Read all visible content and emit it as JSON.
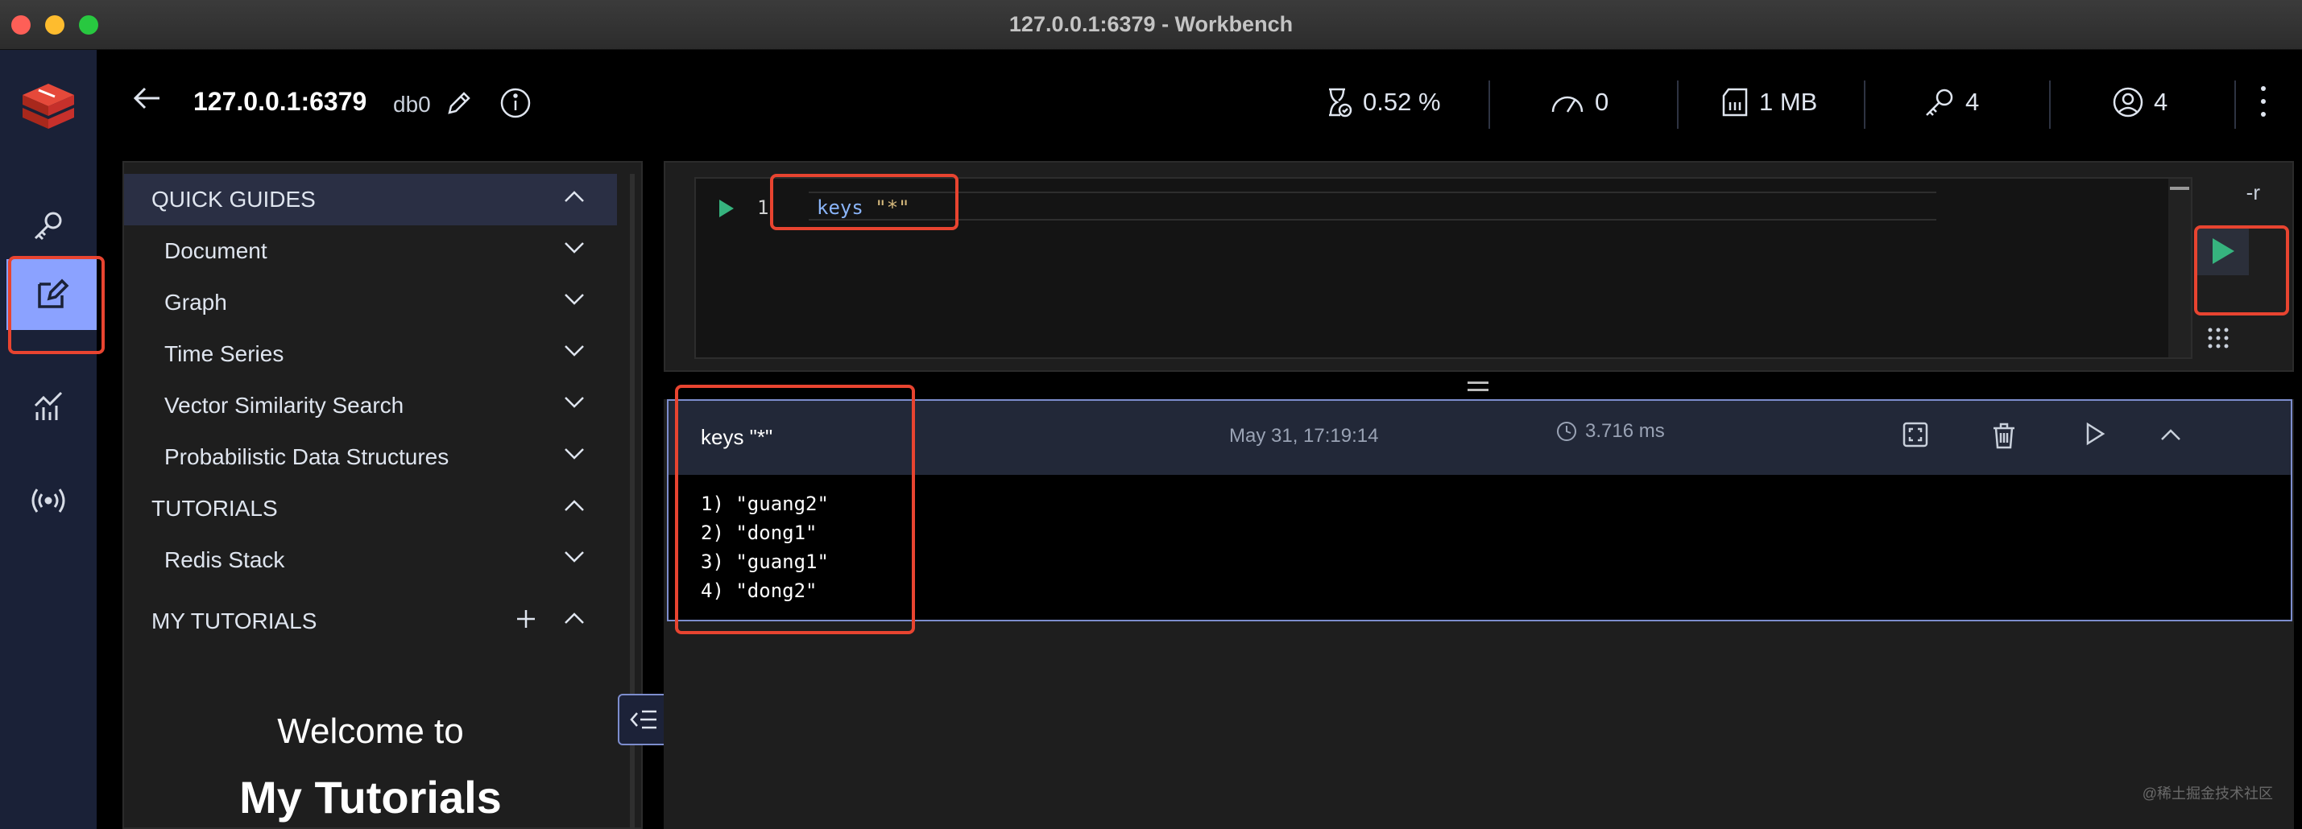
{
  "window": {
    "title": "127.0.0.1:6379 - Workbench"
  },
  "header": {
    "host": "127.0.0.1:6379",
    "db": "db0",
    "stats": {
      "cpu": "0.52 %",
      "ops": "0",
      "memory": "1 MB",
      "keys": "4",
      "clients": "4"
    }
  },
  "nav": {
    "items": [
      "browser",
      "workbench",
      "analytics",
      "pub-sub"
    ],
    "active": "workbench"
  },
  "guides": {
    "quick_guides_title": "QUICK GUIDES",
    "quick_guides": [
      "Document",
      "Graph",
      "Time Series",
      "Vector Similarity Search",
      "Probabilistic Data Structures"
    ],
    "tutorials_title": "TUTORIALS",
    "tutorials": [
      "Redis Stack"
    ],
    "my_tutorials_title": "MY TUTORIALS",
    "welcome_line1": "Welcome to",
    "welcome_line2": "My Tutorials"
  },
  "editor": {
    "line_number": "1",
    "command_keyword": "keys",
    "command_arg": " \"*\"",
    "raw_mode_label": "-r"
  },
  "result": {
    "command": "keys \"*\"",
    "date": "May 31, 17:19:14",
    "duration": "3.716 ms",
    "lines": [
      "1) \"guang2\"",
      "2) \"dong1\"",
      "3) \"guang1\"",
      "4) \"dong2\""
    ]
  },
  "watermark": "@稀土掘金技术社区",
  "colors": {
    "accent": "#8ba2ff",
    "run_green": "#36b37e",
    "annotation_red": "#e84430",
    "brand_red": "#dc382c"
  }
}
